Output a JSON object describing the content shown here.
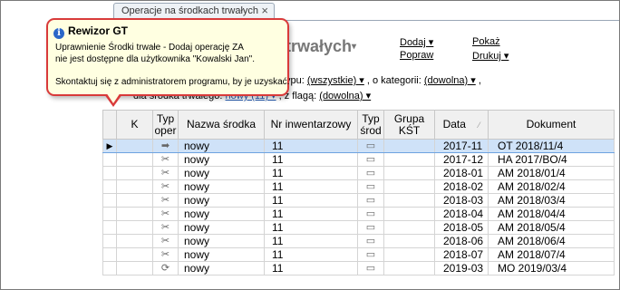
{
  "tab": {
    "title": "Operacje na środkach trwałych",
    "close": "×"
  },
  "page": {
    "title": "trwałych",
    "title_arrow": "▾"
  },
  "menu": {
    "dodaj": "Dodaj ▾",
    "popraw": "Popraw",
    "pokaz": "Pokaż",
    "drukuj": "Drukuj ▾"
  },
  "filters": {
    "line1_prefix": "ypu:",
    "typ_value": "(wszystkie) ▾",
    "line1_mid": ", o kategorii:",
    "kategoria_value": "(dowolna) ▾",
    "line1_end": ",",
    "line2_prefix": "dla środka trwałego:",
    "srodek_value": "nowy (11) ▾",
    "line2_mid": ", z flagą:",
    "flaga_value": "(dowolna) ▾"
  },
  "table": {
    "columns": [
      "",
      "K",
      "Typ oper",
      "Nazwa środka",
      "Nr inwentarzowy",
      "Typ środ",
      "Grupa KŚT",
      "Data",
      "Dokument"
    ],
    "sort_indicator": "⁄",
    "rows": [
      {
        "indicator": "▶",
        "typ_icon": "➡",
        "nazwa": "nowy",
        "nr": "11",
        "typsrod_icon": "▭",
        "data": "2017-11",
        "dokument": "OT 2018/11/4",
        "selected": true
      },
      {
        "indicator": "",
        "typ_icon": "✂",
        "nazwa": "nowy",
        "nr": "11",
        "typsrod_icon": "▭",
        "data": "2017-12",
        "dokument": "HA 2017/BO/4",
        "selected": false
      },
      {
        "indicator": "",
        "typ_icon": "✂",
        "nazwa": "nowy",
        "nr": "11",
        "typsrod_icon": "▭",
        "data": "2018-01",
        "dokument": "AM 2018/01/4",
        "selected": false
      },
      {
        "indicator": "",
        "typ_icon": "✂",
        "nazwa": "nowy",
        "nr": "11",
        "typsrod_icon": "▭",
        "data": "2018-02",
        "dokument": "AM 2018/02/4",
        "selected": false
      },
      {
        "indicator": "",
        "typ_icon": "✂",
        "nazwa": "nowy",
        "nr": "11",
        "typsrod_icon": "▭",
        "data": "2018-03",
        "dokument": "AM 2018/03/4",
        "selected": false
      },
      {
        "indicator": "",
        "typ_icon": "✂",
        "nazwa": "nowy",
        "nr": "11",
        "typsrod_icon": "▭",
        "data": "2018-04",
        "dokument": "AM 2018/04/4",
        "selected": false
      },
      {
        "indicator": "",
        "typ_icon": "✂",
        "nazwa": "nowy",
        "nr": "11",
        "typsrod_icon": "▭",
        "data": "2018-05",
        "dokument": "AM 2018/05/4",
        "selected": false
      },
      {
        "indicator": "",
        "typ_icon": "✂",
        "nazwa": "nowy",
        "nr": "11",
        "typsrod_icon": "▭",
        "data": "2018-06",
        "dokument": "AM 2018/06/4",
        "selected": false
      },
      {
        "indicator": "",
        "typ_icon": "✂",
        "nazwa": "nowy",
        "nr": "11",
        "typsrod_icon": "▭",
        "data": "2018-07",
        "dokument": "AM 2018/07/4",
        "selected": false
      },
      {
        "indicator": "",
        "typ_icon": "⟳",
        "nazwa": "nowy",
        "nr": "11",
        "typsrod_icon": "▭",
        "data": "2019-03",
        "dokument": "MO 2019/03/4",
        "selected": false
      }
    ]
  },
  "tooltip": {
    "icon": "i",
    "title": "Rewizor GT",
    "message_line1": "Uprawnienie Środki trwałe - Dodaj operację ZA",
    "message_line2": "nie jest dostępne dla użytkownika \"Kowalski Jan\".",
    "message_line3": "Skontaktuj się z administratorem programu, by je uzyskać."
  },
  "colors": {
    "tooltip_border": "#d93a3a",
    "tooltip_bg": "#ffffe1",
    "selected_row": "#cfe2f8"
  }
}
